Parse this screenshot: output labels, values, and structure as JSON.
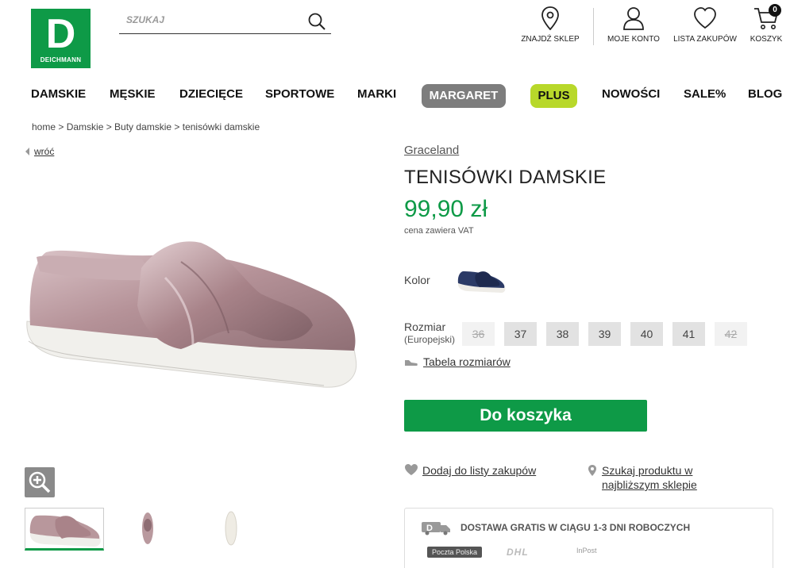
{
  "header": {
    "logo_letter": "D",
    "logo_brand": "DEICHMANN",
    "search_placeholder": "SZUKAJ",
    "links": {
      "store": "ZNAJDŹ SKLEP",
      "account": "MOJE KONTO",
      "wishlist": "LISTA ZAKUPÓW",
      "cart": "KOSZYK"
    },
    "cart_count": "0"
  },
  "nav": {
    "items": [
      "DAMSKIE",
      "MĘSKIE",
      "DZIECIĘCE",
      "SPORTOWE",
      "MARKI",
      "MARGARET",
      "PLUS",
      "NOWOŚCI",
      "SALE%",
      "BLOG"
    ]
  },
  "breadcrumb": "home > Damskie > Buty damskie > tenisówki damskie",
  "back_label": "wróć",
  "product": {
    "brand": "Graceland",
    "title": "TENISÓWKI DAMSKIE",
    "price": "99,90 zł",
    "vat_note": "cena zawiera VAT",
    "color_label": "Kolor",
    "size_label": "Rozmiar",
    "size_sub": "(Europejski)",
    "sizes": [
      {
        "label": "36",
        "available": false
      },
      {
        "label": "37",
        "available": true
      },
      {
        "label": "38",
        "available": true
      },
      {
        "label": "39",
        "available": true
      },
      {
        "label": "40",
        "available": true
      },
      {
        "label": "41",
        "available": true
      },
      {
        "label": "42",
        "available": false
      }
    ],
    "size_table_label": "Tabela rozmiarów",
    "add_to_cart": "Do koszyka",
    "wishlist_label": "Dodaj do listy zakupów",
    "store_search_label": "Szukaj produktu w najbliższym sklepie"
  },
  "delivery": {
    "text": "DOSTAWA GRATIS W CIĄGU 1-3 DNI ROBOCZYCH",
    "carriers": [
      "Poczta Polska",
      "DHL",
      "InPost"
    ]
  },
  "colors": {
    "brand_green": "#0e9a47",
    "plus_yellow": "#b8d82a",
    "margaret_gray": "#7d7d7d"
  }
}
